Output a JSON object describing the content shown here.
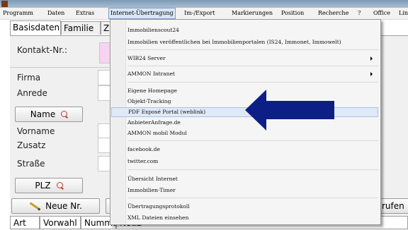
{
  "menubar": {
    "items": [
      "Programm",
      "Daten",
      "Extras",
      "Internet-Übertragung",
      "Im-/Export",
      "Markierungen",
      "Position",
      "Recherche",
      "?",
      "Office",
      "Lin"
    ]
  },
  "tabs": [
    "Basisdaten",
    "Familie",
    "Zus"
  ],
  "form": {
    "kontakt_label": "Kontakt-Nr.:",
    "firma_label": "Firma",
    "anrede_label": "Anrede",
    "name_button": "Name",
    "vorname_label": "Vorname",
    "zusatz_label": "Zusatz",
    "strasse_label": "Straße",
    "plz_button": "PLZ",
    "neue_nr_button": "Neue Nr.",
    "rufen_button": "rufen"
  },
  "table_headers": [
    "Art",
    "Vorwahl",
    "Numme",
    "Notiz"
  ],
  "dropdown": {
    "items": [
      "Immobilienscout24",
      "Immobilien veröffentlichen bei Immobilienportalen (IS24, Immonet, Immowelt)",
      "WIB24 Server",
      "AMMON Intranet",
      "Eigene Homepage",
      "Objekt-Tracking",
      "PDF Exposé Portal (weblink)",
      "AnbieterAnfrage.de",
      "AMMON mobil Modul",
      "facebook.de",
      "twitter.com",
      "Übersicht Internet",
      "Immobilien-Timer",
      "Übertragungsprotokoll",
      "XML Dateien einsehen"
    ]
  },
  "colors": {
    "arrow": "#0d1f86",
    "highlight": "#dfe9f7",
    "kontakt_field": "#f6d3f0"
  }
}
